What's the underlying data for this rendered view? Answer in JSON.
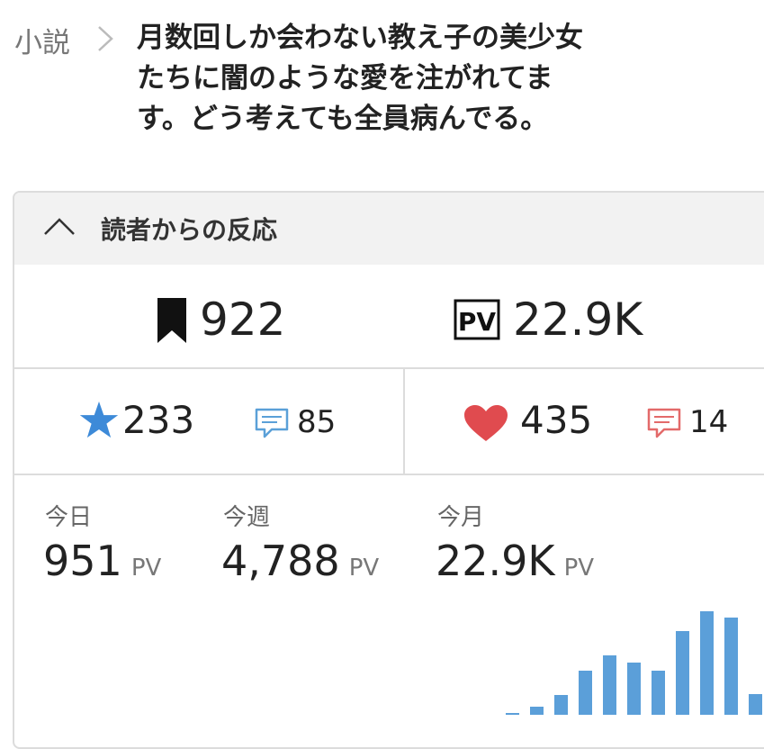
{
  "breadcrumb": {
    "label": "小説"
  },
  "work": {
    "title_lines": [
      "月数回しか会わない教え子の美少女",
      "たちに闇のような愛を注がれてま",
      "す。どう考えても全員病んでる。"
    ]
  },
  "reactions": {
    "header": "読者からの反応",
    "bookmarks": "922",
    "pv_badge": "PV",
    "pv_total": "22.9K",
    "stars": "233",
    "star_comments": "85",
    "hearts": "435",
    "heart_comments": "14"
  },
  "stats": {
    "today": {
      "label": "今日",
      "value": "951",
      "unit": "PV"
    },
    "week": {
      "label": "今週",
      "value": "4,788",
      "unit": "PV"
    },
    "month": {
      "label": "今月",
      "value": "22.9K",
      "unit": "PV"
    }
  },
  "chart_data": {
    "type": "bar",
    "values": [
      1,
      10,
      24,
      53,
      71,
      63,
      53,
      100,
      124,
      116,
      25
    ],
    "ylim": [
      0,
      140
    ],
    "color": "#5b9fd9"
  },
  "colors": {
    "star": "#3d8ad8",
    "heart": "#e04b4f",
    "comment_blue": "#5aa0d8",
    "comment_red": "#e36a6a"
  }
}
